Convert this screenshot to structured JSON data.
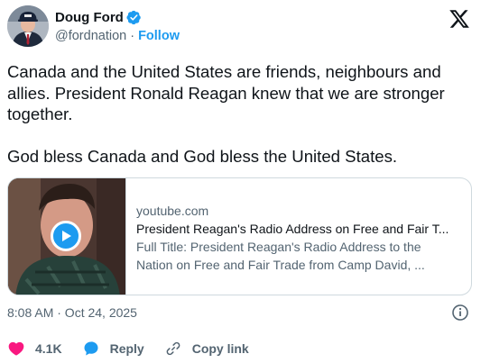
{
  "author": {
    "display_name": "Doug Ford",
    "handle": "@fordnation",
    "separator": "·",
    "follow_label": "Follow"
  },
  "tweet": {
    "text": "Canada and the United States are friends, neighbours and allies. President Ronald Reagan knew that we are stronger together.\n\nGod bless Canada and God bless the United States."
  },
  "card": {
    "domain": "youtube.com",
    "title": "President Reagan's Radio Address on Free and Fair T...",
    "description_line1": "Full Title: President Reagan's Radio Address to the",
    "description_line2": "Nation on Free and Fair Trade from Camp David, ..."
  },
  "meta": {
    "timestamp": "8:08 AM · Oct 24, 2025"
  },
  "actions": {
    "like_count": "4.1K",
    "reply_label": "Reply",
    "copy_link_label": "Copy link"
  },
  "colors": {
    "accent": "#1d9bf0",
    "like": "#f91880",
    "text_primary": "#0f1419",
    "text_secondary": "#536471",
    "border": "#cfd9de"
  },
  "icons": {
    "verified": "verified-badge-icon",
    "brand": "x-logo-icon",
    "play": "play-icon",
    "info": "info-icon",
    "like": "heart-icon",
    "reply": "speech-bubble-icon",
    "copy_link": "link-icon"
  }
}
